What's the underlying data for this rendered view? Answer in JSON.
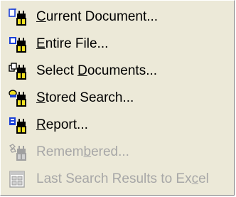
{
  "menu": {
    "items": [
      {
        "pre": "",
        "accel": "C",
        "post": "urrent Document...",
        "icon": "document-page-icon",
        "enabled": true
      },
      {
        "pre": "",
        "accel": "E",
        "post": "ntire File...",
        "icon": "file-icon",
        "enabled": true
      },
      {
        "pre": "Select ",
        "accel": "D",
        "post": "ocuments...",
        "icon": "select-documents-icon",
        "enabled": true
      },
      {
        "pre": "",
        "accel": "S",
        "post": "tored Search...",
        "icon": "stored-search-icon",
        "enabled": true
      },
      {
        "pre": "",
        "accel": "R",
        "post": "eport...",
        "icon": "report-icon",
        "enabled": true
      },
      {
        "pre": "Remem",
        "accel": "b",
        "post": "ered...",
        "icon": "remembered-icon",
        "enabled": false
      },
      {
        "pre": "Last Search Results to Ex",
        "accel": "c",
        "post": "el",
        "icon": "excel-icon",
        "enabled": false
      }
    ],
    "colors": {
      "background": "#ece9d8",
      "text": "#000000",
      "disabled_text": "#a7a7a7",
      "icon_blue": "#1a3fd6",
      "icon_yellow": "#f0e020",
      "icon_dark": "#000000"
    }
  }
}
